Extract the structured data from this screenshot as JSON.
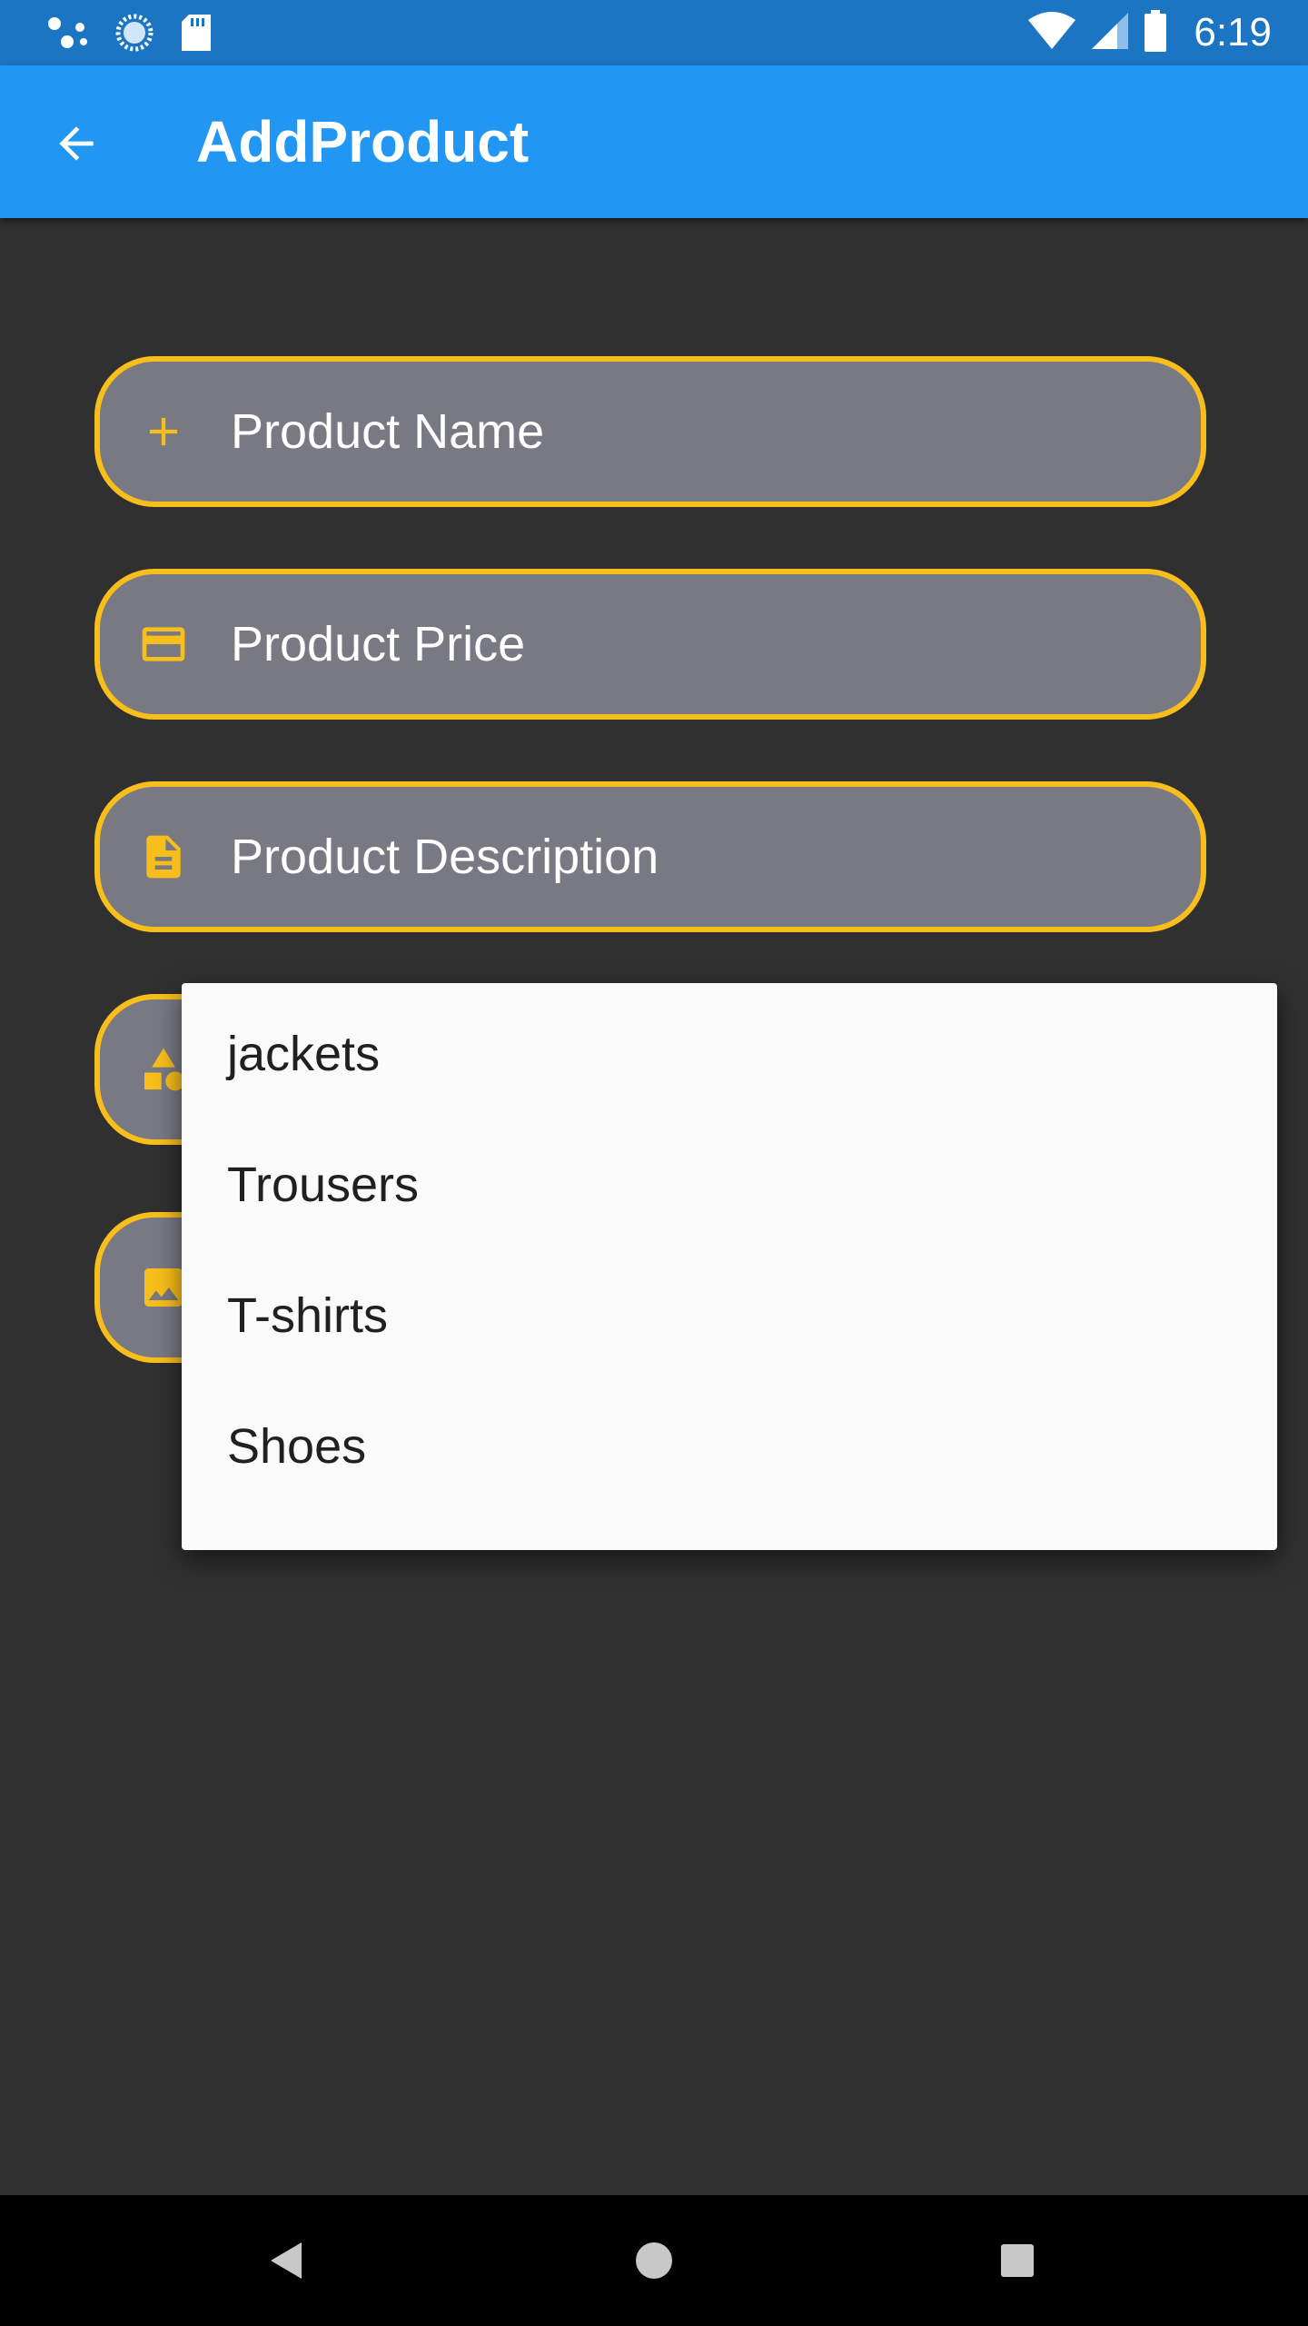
{
  "status_bar": {
    "time": "6:19",
    "icons": [
      "assistant-dots-icon",
      "sync-icon",
      "sd-card-icon",
      "wifi-icon",
      "signal-icon",
      "battery-icon"
    ]
  },
  "app_bar": {
    "title": "AddProduct",
    "back_icon": "arrow-back-icon",
    "background_color": "#2196f3"
  },
  "form": {
    "accent_color": "#f8be1b",
    "fields": [
      {
        "label": "Product Name",
        "icon": "plus-icon"
      },
      {
        "label": "Product Price",
        "icon": "credit-card-icon"
      },
      {
        "label": "Product Description",
        "icon": "document-icon"
      },
      {
        "label": "",
        "icon": "category-shapes-icon"
      },
      {
        "label": "",
        "icon": "image-icon"
      }
    ]
  },
  "category_dropdown": {
    "options": [
      "jackets",
      "Trousers",
      "T-shirts",
      "Shoes"
    ]
  },
  "nav_bar": {
    "buttons": [
      "back-triangle-icon",
      "home-circle-icon",
      "recents-square-icon"
    ]
  }
}
